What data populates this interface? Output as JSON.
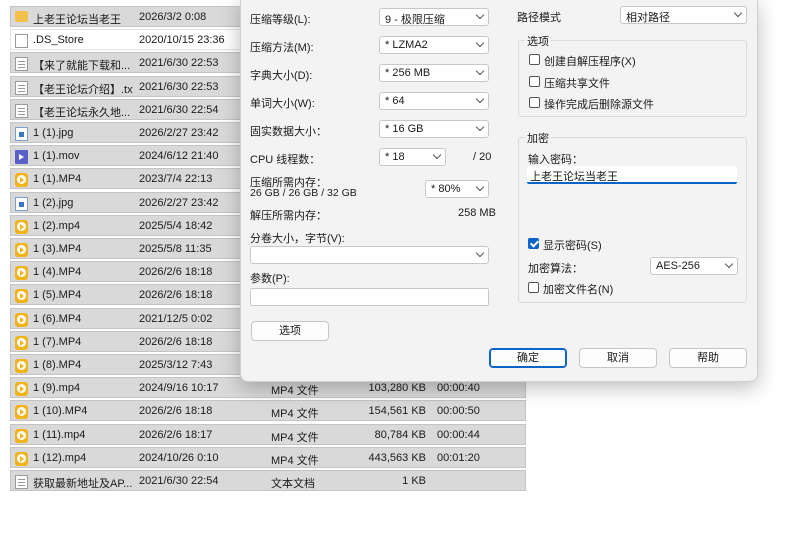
{
  "file_list": {
    "rows": [
      {
        "icon": "folder-icon",
        "name": "上老王论坛当老王",
        "date": "2026/3/2 0:08",
        "type": "",
        "size": "",
        "duration": ""
      },
      {
        "icon": "file-icon",
        "name": ".DS_Store",
        "date": "2020/10/15 23:36",
        "type": "",
        "size": "",
        "duration": ""
      },
      {
        "icon": "text-file-icon",
        "name": "【来了就能下载和...",
        "date": "2021/6/30 22:53",
        "type": "",
        "size": "",
        "duration": ""
      },
      {
        "icon": "text-file-icon",
        "name": "【老王论坛介绍】.txt",
        "date": "2021/6/30 22:53",
        "type": "",
        "size": "",
        "duration": ""
      },
      {
        "icon": "text-file-icon",
        "name": "【老王论坛永久地...",
        "date": "2021/6/30 22:54",
        "type": "",
        "size": "",
        "duration": ""
      },
      {
        "icon": "image-file-icon",
        "name": "1 (1).jpg",
        "date": "2026/2/27 23:42",
        "type": "",
        "size": "",
        "duration": ""
      },
      {
        "icon": "mov-file-icon",
        "name": "1 (1).mov",
        "date": "2024/6/12 21:40",
        "type": "",
        "size": "",
        "duration": ""
      },
      {
        "icon": "video-file-icon",
        "name": "1 (1).MP4",
        "date": "2023/7/4 22:13",
        "type": "",
        "size": "",
        "duration": ""
      },
      {
        "icon": "image-file-icon",
        "name": "1 (2).jpg",
        "date": "2026/2/27 23:42",
        "type": "",
        "size": "",
        "duration": ""
      },
      {
        "icon": "video-file-icon",
        "name": "1 (2).mp4",
        "date": "2025/5/4 18:42",
        "type": "",
        "size": "",
        "duration": ""
      },
      {
        "icon": "video-file-icon",
        "name": "1 (3).MP4",
        "date": "2025/5/8 11:35",
        "type": "",
        "size": "",
        "duration": ""
      },
      {
        "icon": "video-file-icon",
        "name": "1 (4).MP4",
        "date": "2026/2/6 18:18",
        "type": "",
        "size": "",
        "duration": ""
      },
      {
        "icon": "video-file-icon",
        "name": "1 (5).MP4",
        "date": "2026/2/6 18:18",
        "type": "",
        "size": "",
        "duration": ""
      },
      {
        "icon": "video-file-icon",
        "name": "1 (6).MP4",
        "date": "2021/12/5 0:02",
        "type": "",
        "size": "",
        "duration": ""
      },
      {
        "icon": "video-file-icon",
        "name": "1 (7).MP4",
        "date": "2026/2/6 18:18",
        "type": "",
        "size": "",
        "duration": ""
      },
      {
        "icon": "video-file-icon",
        "name": "1 (8).MP4",
        "date": "2025/3/12 7:43",
        "type": "",
        "size": "",
        "duration": ""
      },
      {
        "icon": "video-file-icon",
        "name": "1 (9).mp4",
        "date": "2024/9/16 10:17",
        "type": "MP4 文件",
        "size": "103,280 KB",
        "duration": "00:00:40"
      },
      {
        "icon": "video-file-icon",
        "name": "1 (10).MP4",
        "date": "2026/2/6 18:18",
        "type": "MP4 文件",
        "size": "154,561 KB",
        "duration": "00:00:50"
      },
      {
        "icon": "video-file-icon",
        "name": "1 (11).mp4",
        "date": "2026/2/6 18:17",
        "type": "MP4 文件",
        "size": "80,784 KB",
        "duration": "00:00:44"
      },
      {
        "icon": "video-file-icon",
        "name": "1 (12).mp4",
        "date": "2024/10/26 0:10",
        "type": "MP4 文件",
        "size": "443,563 KB",
        "duration": "00:01:20"
      },
      {
        "icon": "text-file-icon",
        "name": "获取最新地址及AP...",
        "date": "2021/6/30 22:54",
        "type": "文本文档",
        "size": "1 KB",
        "duration": ""
      }
    ]
  },
  "dialog": {
    "compression_level": {
      "label": "压缩等级(L):",
      "value": "9 - 极限压缩"
    },
    "compression_method": {
      "label": "压缩方法(M):",
      "value": "* LZMA2"
    },
    "dictionary_size": {
      "label": "字典大小(D):",
      "value": "* 256 MB"
    },
    "word_size": {
      "label": "单词大小(W):",
      "value": "* 64"
    },
    "solid_block": {
      "label": "固实数据大小：",
      "value": "* 16 GB"
    },
    "cpu_threads": {
      "label": "CPU 线程数：",
      "value": "* 18",
      "total": "/ 20"
    },
    "memory_compress": {
      "label": "压缩所需内存：",
      "detail": "26 GB / 26 GB / 32 GB",
      "percent": "* 80%"
    },
    "memory_decompress": {
      "label": "解压所需内存：",
      "value": "258 MB"
    },
    "split_volume": {
      "label": "分卷大小，字节(V):",
      "value": ""
    },
    "parameters": {
      "label": "参数(P):",
      "value": ""
    },
    "options_button": "选项",
    "path_mode": {
      "label": "路径模式",
      "value": "相对路径"
    },
    "options_group": {
      "title": "选项",
      "create_sfx": "创建自解压程序(X)",
      "compress_shared": "压缩共享文件",
      "delete_after": "操作完成后删除源文件"
    },
    "encryption_group": {
      "title": "加密",
      "password_label": "输入密码：",
      "password_value": "上老王论坛当老王",
      "show_password": "显示密码(S)",
      "method_label": "加密算法：",
      "method_value": "AES-256",
      "encrypt_names": "加密文件名(N)"
    },
    "buttons": {
      "ok": "确定",
      "cancel": "取消",
      "help": "帮助"
    }
  }
}
